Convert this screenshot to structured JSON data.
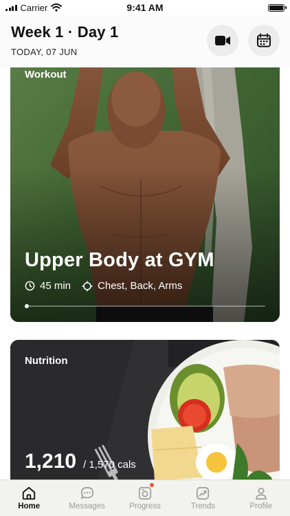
{
  "status_bar": {
    "carrier": "Carrier",
    "time": "9:41 AM"
  },
  "header": {
    "title": "Week 1 · Day 1",
    "subtitle": "TODAY, 07 JUN"
  },
  "workout_card": {
    "label": "Workout",
    "title": "Upper Body at GYM",
    "duration": "45 min",
    "focus": "Chest, Back, Arms",
    "progress_fraction": 0.0
  },
  "nutrition_card": {
    "label": "Nutrition",
    "calories": "1,210",
    "calories_target": "/ 1,570 cals"
  },
  "tabs": [
    {
      "label": "Home",
      "icon": "home-icon",
      "active": true
    },
    {
      "label": "Messages",
      "icon": "chat-icon",
      "active": false
    },
    {
      "label": "Progress",
      "icon": "camera-icon",
      "active": false,
      "badge": true
    },
    {
      "label": "Trends",
      "icon": "trend-icon",
      "active": false
    },
    {
      "label": "Profile",
      "icon": "person-icon",
      "active": false
    }
  ],
  "colors": {
    "accent": "#111111",
    "badge": "#e8533a",
    "tab_inactive": "#9a9a9a"
  }
}
